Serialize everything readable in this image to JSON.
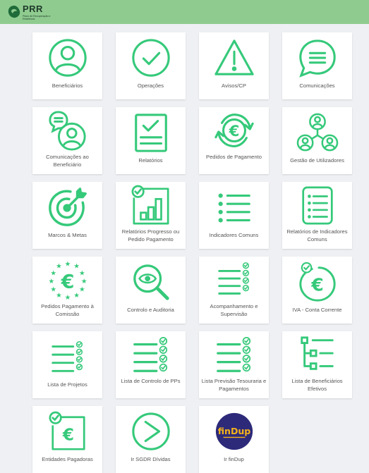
{
  "header": {
    "logo_text": "PRR",
    "logo_subtitle": "Plano de Recuperação e Resiliência"
  },
  "colors": {
    "accent": "#35c97a",
    "topbar": "#8fcb8f",
    "findup_bg": "#2d2a7a",
    "findup_text": "#f4b21b"
  },
  "tiles": [
    {
      "label": "Beneficiários",
      "icon": "user-circle-icon"
    },
    {
      "label": "Operações",
      "icon": "check-circle-icon"
    },
    {
      "label": "Avisos/CP",
      "icon": "warning-triangle-icon"
    },
    {
      "label": "Comunicações",
      "icon": "chat-bubble-icon"
    },
    {
      "label": "Comunicações ao Beneficiário",
      "icon": "user-message-icon"
    },
    {
      "label": "Relatórios",
      "icon": "report-check-icon"
    },
    {
      "label": "Pedidos de Pagamento",
      "icon": "euro-refresh-icon"
    },
    {
      "label": "Gestão de Utilizadores",
      "icon": "users-network-icon"
    },
    {
      "label": "Marcos & Metas",
      "icon": "target-icon"
    },
    {
      "label": "Relatórios Progresso ou Pedido Pagamento",
      "icon": "bar-chart-icon"
    },
    {
      "label": "Indicadores Comuns",
      "icon": "bullet-list-icon"
    },
    {
      "label": "Relatórios de Indicadores Comuns",
      "icon": "list-document-icon"
    },
    {
      "label": "Pedidos Pagamento à Comissão",
      "icon": "euro-stars-icon"
    },
    {
      "label": "Controlo e Auditoria",
      "icon": "magnify-eye-icon"
    },
    {
      "label": "Acompanhamento e Supervisão",
      "icon": "checklist-icon"
    },
    {
      "label": "IVA - Conta Corrente",
      "icon": "euro-check-circle-icon"
    },
    {
      "label": "Lista de Projetos",
      "icon": "checklist-icon"
    },
    {
      "label": "Lista de Controlo de PPs",
      "icon": "checklist-icon"
    },
    {
      "label": "Lista Previsão Tesouraria e Pagamentos",
      "icon": "checklist-icon"
    },
    {
      "label": "Lista de Beneficiários Efetivos",
      "icon": "tree-list-icon"
    },
    {
      "label": "Entidades Pagadoras",
      "icon": "euro-document-icon"
    },
    {
      "label": "Ir SGDR Dívidas",
      "icon": "play-circle-icon"
    },
    {
      "label": "Ir finDup",
      "icon": "findup-logo-icon",
      "logo_text": "finDup"
    }
  ]
}
